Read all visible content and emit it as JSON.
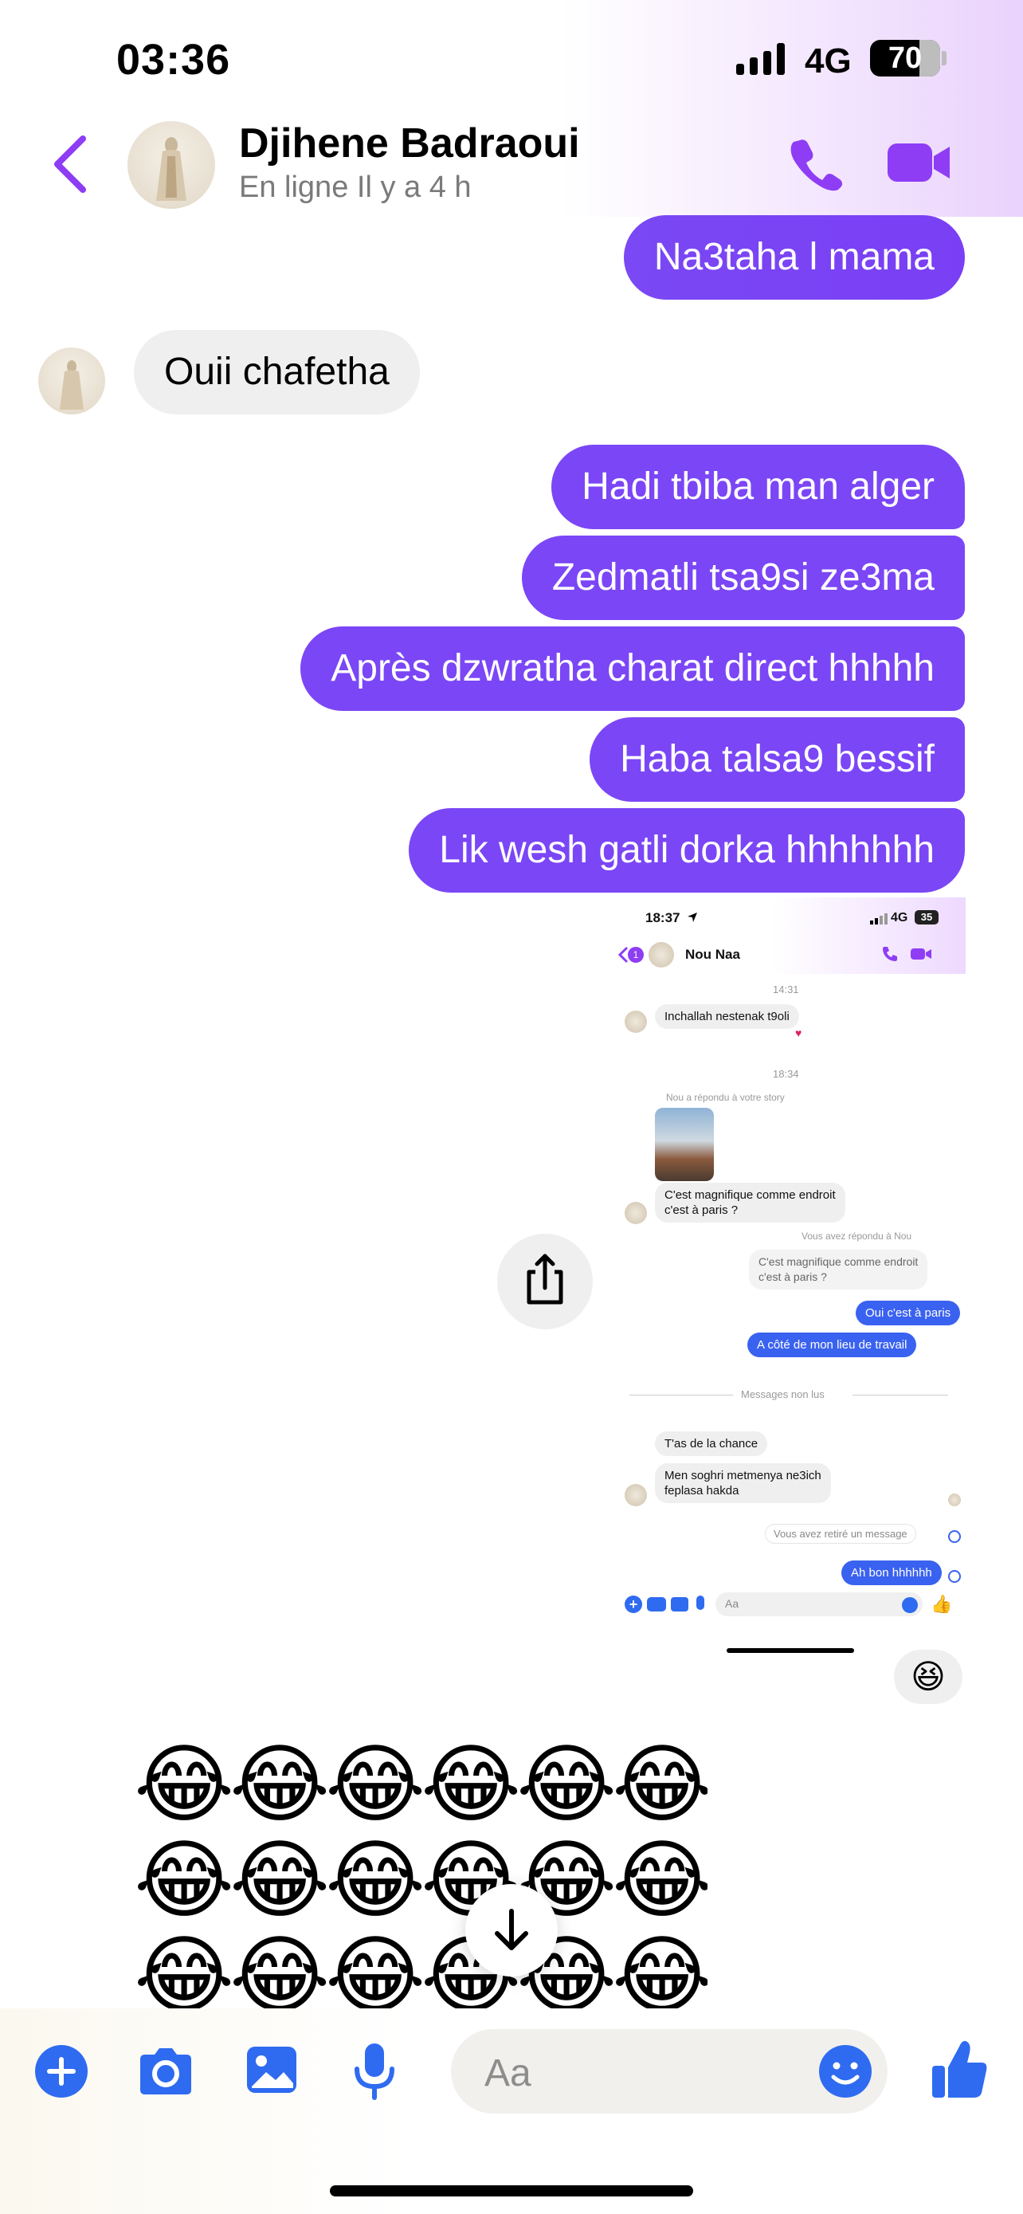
{
  "status_bar": {
    "time": "03:36",
    "network": "4G",
    "battery": "70",
    "battery_level": 0.7
  },
  "header": {
    "contact_name": "Djihene Badraoui",
    "contact_status": "En ligne Il y a 4 h"
  },
  "messages": [
    {
      "from": "me",
      "text": "Na3taha l mama"
    },
    {
      "from": "them",
      "text": "Ouii chafetha"
    },
    {
      "from": "me",
      "text": "Hadi tbiba man alger"
    },
    {
      "from": "me",
      "text": "Zedmatli tsa9si ze3ma"
    },
    {
      "from": "me",
      "text": "Après dzwratha charat direct hhhhh"
    },
    {
      "from": "me",
      "text": "Haba talsa9 bessif"
    },
    {
      "from": "me",
      "text": "Lik wesh gatli dorka hhhhhhh"
    }
  ],
  "shared_screenshot": {
    "time": "18:37",
    "network": "4G",
    "battery": "35",
    "contact": "Nou Naa",
    "unread_count": "1",
    "ts1": "14:31",
    "msg1": "Inchallah nestenak t9oli",
    "ts2": "18:34",
    "story_reply_label": "Nou a répondu à votre story",
    "msg2_line1": "C'est magnifique comme endroit",
    "msg2_line2": "c'est à paris ?",
    "you_replied_label": "Vous avez répondu à Nou",
    "quoted_line1": "C'est magnifique comme endroit",
    "quoted_line2": "c'est à paris ?",
    "reply1": "Oui c'est à paris",
    "reply2": "A côté de mon lieu de travail",
    "unread_divider": "Messages non lus",
    "msg3": "T'as de la chance",
    "msg4_line1": "Men soghri metmenya ne3ich",
    "msg4_line2": "feplasa hakda",
    "removed_notice": "Vous avez retiré un message",
    "reply3": "Ah bon hhhhhh",
    "input_placeholder": "Aa"
  },
  "reaction_emoji": "😆",
  "emoji_rows": [
    [
      "😂",
      "😂",
      "😂",
      "😂",
      "😂",
      "😂"
    ],
    [
      "😂",
      "😂",
      "😂",
      "😂",
      "😂",
      "😂"
    ],
    [
      "😂",
      "😂",
      "😂",
      "😂",
      "😂",
      "😂"
    ]
  ],
  "composer": {
    "placeholder": "Aa"
  },
  "colors": {
    "accent": "#7b46f6",
    "icon_blue": "#2f6bf0",
    "purple_icon": "#8e3df5"
  }
}
